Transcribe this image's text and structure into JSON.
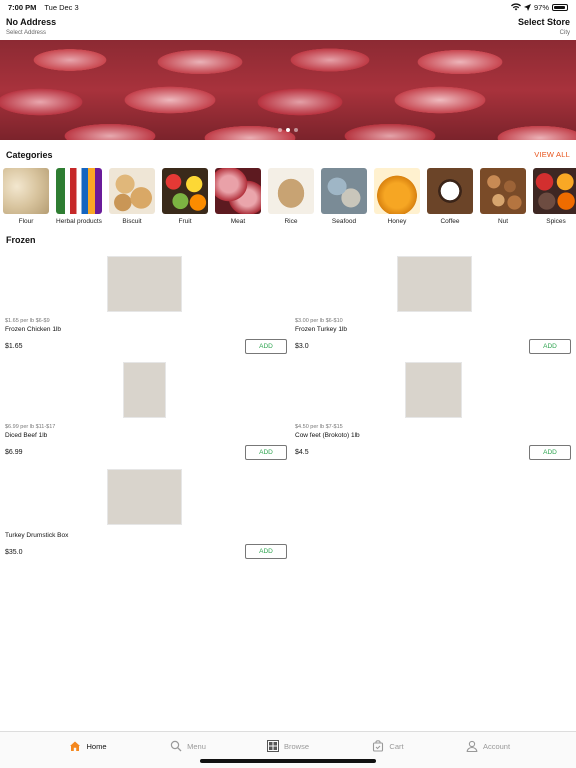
{
  "status_bar": {
    "time": "7:00 PM",
    "date": "Tue Dec 3",
    "battery": "97%"
  },
  "header": {
    "address_title": "No Address",
    "address_subtitle": "Select Address",
    "store_title": "Select Store",
    "store_subtitle": "City"
  },
  "banner": {
    "slide_count": 3,
    "active_slide": 2
  },
  "categories": {
    "title": "Categories",
    "view_all": "VIEW ALL",
    "items": [
      {
        "label": "Flour"
      },
      {
        "label": "Herbal products"
      },
      {
        "label": "Biscuit"
      },
      {
        "label": "Fruit"
      },
      {
        "label": "Meat"
      },
      {
        "label": "Rice"
      },
      {
        "label": "Seafood"
      },
      {
        "label": "Honey"
      },
      {
        "label": "Coffee"
      },
      {
        "label": "Nut"
      },
      {
        "label": "Spices"
      }
    ]
  },
  "frozen": {
    "title": "Frozen",
    "add_label": "ADD",
    "products": [
      {
        "meta": "$1.65 per lb $6-$9",
        "name": "Frozen Chicken 1lb",
        "price": "$1.65"
      },
      {
        "meta": "$3.00 per lb $6-$10",
        "name": "Frozen Turkey 1lb",
        "price": "$3.0"
      },
      {
        "meta": "$6.99 per lb $11-$17",
        "name": "Diced Beef 1lb",
        "price": "$6.99"
      },
      {
        "meta": "$4.50 per lb $7-$15",
        "name": "Cow feet (Brokoto) 1lb",
        "price": "$4.5"
      },
      {
        "meta": "",
        "name": "Turkey Drumstick Box",
        "price": "$35.0"
      }
    ]
  },
  "tabbar": {
    "tabs": [
      {
        "label": "Home",
        "icon": "home-icon",
        "active": true
      },
      {
        "label": "Menu",
        "icon": "search-icon",
        "active": false
      },
      {
        "label": "Browse",
        "icon": "grid-icon",
        "active": false
      },
      {
        "label": "Cart",
        "icon": "cart-icon",
        "active": false
      },
      {
        "label": "Account",
        "icon": "account-icon",
        "active": false
      }
    ]
  },
  "colors": {
    "accent": "#e8541c",
    "add_text": "#2ea44f",
    "home_active": "#f4881f"
  }
}
